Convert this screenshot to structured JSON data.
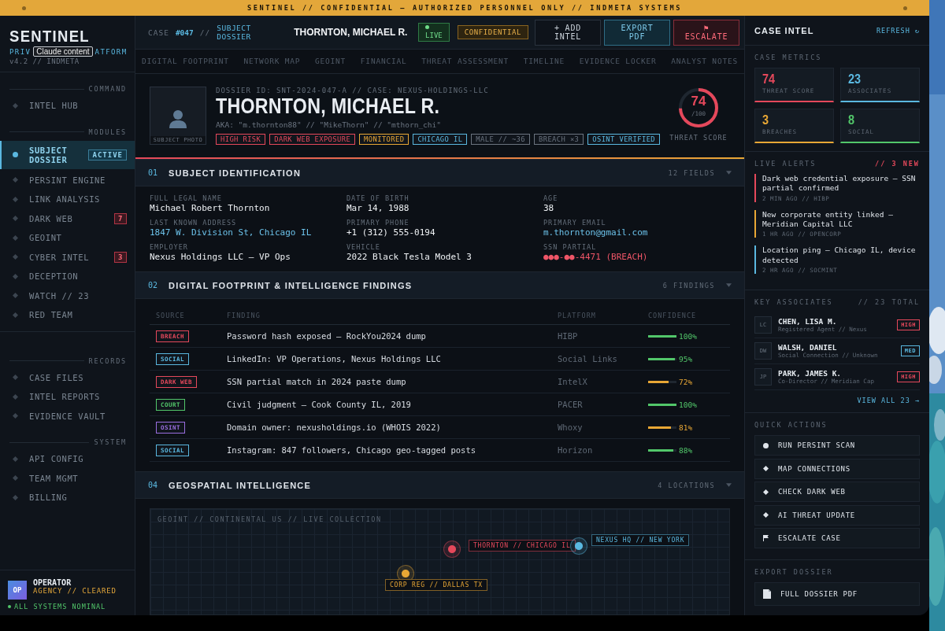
{
  "banner": {
    "text": "SENTINEL // CONFIDENTIAL — AUTHORIZED PERSONNEL ONLY // INDMETA SYSTEMS"
  },
  "sidebar": {
    "logo": "SENTINEL",
    "subtitle_left": "PRIV",
    "subtitle_right": "ATFORM",
    "tooltip": "Claude content",
    "version": "v4.2 // INDMETA",
    "sections": [
      {
        "title": "COMMAND",
        "items": [
          {
            "label": "INTEL HUB",
            "selected": false
          }
        ]
      },
      {
        "title": "MODULES",
        "items": [
          {
            "label": "SUBJECT DOSSIER",
            "selected": true,
            "badge": "ACTIVE"
          },
          {
            "label": "PERSINT ENGINE",
            "selected": false
          },
          {
            "label": "LINK ANALYSIS",
            "selected": false
          },
          {
            "label": "DARK WEB",
            "selected": false,
            "badge": "7"
          },
          {
            "label": "GEOINT",
            "selected": false
          },
          {
            "label": "CYBER INTEL",
            "selected": false,
            "badge": "3"
          },
          {
            "label": "DECEPTION",
            "selected": false
          },
          {
            "label": "WATCH // 23",
            "selected": false
          },
          {
            "label": "RED TEAM",
            "selected": false
          }
        ]
      },
      {
        "title": "RECORDS",
        "items": [
          {
            "label": "CASE FILES",
            "selected": false
          },
          {
            "label": "INTEL REPORTS",
            "selected": false
          },
          {
            "label": "EVIDENCE VAULT",
            "selected": false
          }
        ]
      },
      {
        "title": "SYSTEM",
        "items": [
          {
            "label": "API CONFIG",
            "selected": false
          },
          {
            "label": "TEAM MGMT",
            "selected": false
          },
          {
            "label": "BILLING",
            "selected": false
          }
        ]
      }
    ],
    "operator": {
      "initials": "OP",
      "name": "OPERATOR",
      "role": "AGENCY // CLEARED",
      "status": "ALL SYSTEMS NOMINAL"
    }
  },
  "header": {
    "case_label": "CASE",
    "case_number": "#047",
    "separator": "//",
    "section": "SUBJECT DOSSIER",
    "subject": "THORNTON, MICHAEL R.",
    "status": "LIVE",
    "classification": "CONFIDENTIAL",
    "buttons": [
      {
        "label": "+ ADD INTEL",
        "kind": "default"
      },
      {
        "label": "EXPORT PDF",
        "kind": "export"
      },
      {
        "label": "⚑ ESCALATE",
        "kind": "danger"
      }
    ]
  },
  "tabs": [
    {
      "label": "DIGITAL FOOTPRINT",
      "selected": false
    },
    {
      "label": "NETWORK MAP",
      "selected": false
    },
    {
      "label": "GEOINT",
      "selected": false
    },
    {
      "label": "FINANCIAL",
      "selected": false
    },
    {
      "label": "THREAT ASSESSMENT",
      "selected": false
    },
    {
      "label": "TIMELINE",
      "selected": false
    },
    {
      "label": "EVIDENCE LOCKER",
      "selected": false
    },
    {
      "label": "ANALYST NOTES",
      "selected": false
    }
  ],
  "dossier": {
    "photo_label": "SUBJECT PHOTO",
    "id_line": "DOSSIER ID: SNT-2024-047-A // CASE: NEXUS-HOLDINGS-LLC",
    "name": "THORNTON, MICHAEL R.",
    "aka": "AKA: \"m.thornton88\" // \"MikeThorn\" // \"mthorn_chi\"",
    "tags": [
      {
        "label": "HIGH RISK",
        "color": "#e5485b"
      },
      {
        "label": "DARK WEB EXPOSURE",
        "color": "#e5485b"
      },
      {
        "label": "MONITORED",
        "color": "#e8a735"
      },
      {
        "label": "CHICAGO IL",
        "color": "#5ab8e0"
      },
      {
        "label": "MALE // ~36",
        "color": "#6b7480"
      },
      {
        "label": "BREACH ×3",
        "color": "#6b7480"
      },
      {
        "label": "OSINT VERIFIED",
        "color": "#5ab8e0"
      }
    ],
    "threat": {
      "score": "74",
      "max": "/100",
      "label": "THREAT SCORE"
    }
  },
  "identification": {
    "number": "01",
    "title": "SUBJECT IDENTIFICATION",
    "count": "12 FIELDS",
    "fields": [
      {
        "label": "FULL LEGAL NAME",
        "value": "Michael Robert Thornton",
        "kind": "text"
      },
      {
        "label": "DATE OF BIRTH",
        "value": "Mar 14, 1988",
        "kind": "text"
      },
      {
        "label": "AGE",
        "value": "38",
        "kind": "text"
      },
      {
        "label": "LAST KNOWN ADDRESS",
        "value": "1847 W. Division St, Chicago IL",
        "kind": "link"
      },
      {
        "label": "PRIMARY PHONE",
        "value": "+1 (312) 555-0194",
        "kind": "text"
      },
      {
        "label": "PRIMARY EMAIL",
        "value": "m.thornton@gmail.com",
        "kind": "link"
      },
      {
        "label": "EMPLOYER",
        "value": "Nexus Holdings LLC — VP Ops",
        "kind": "text"
      },
      {
        "label": "VEHICLE",
        "value": "2022 Black Tesla Model 3",
        "kind": "text"
      },
      {
        "label": "SSN PARTIAL",
        "value": "●●●-●●-4471 (BREACH)",
        "kind": "alert"
      }
    ]
  },
  "findings": {
    "number": "02",
    "title": "DIGITAL FOOTPRINT & INTELLIGENCE FINDINGS",
    "count": "6 FINDINGS",
    "columns": [
      "SOURCE",
      "FINDING",
      "PLATFORM",
      "CONFIDENCE"
    ],
    "rows": [
      {
        "source": "BREACH",
        "color": "#e5485b",
        "finding": "Password hash exposed — RockYou2024 dump",
        "platform": "HIBP",
        "level": 1.0,
        "confidence": "100%"
      },
      {
        "source": "SOCIAL",
        "color": "#5ab8e0",
        "finding": "LinkedIn: VP Operations, Nexus Holdings LLC",
        "platform": "Social Links",
        "level": 0.95,
        "confidence": "95%"
      },
      {
        "source": "DARK WEB",
        "color": "#e5485b",
        "finding": "SSN partial match in 2024 paste dump",
        "platform": "IntelX",
        "level": 0.72,
        "confidence": "72%"
      },
      {
        "source": "COURT",
        "color": "#52c76a",
        "finding": "Civil judgment — Cook County IL, 2019",
        "platform": "PACER",
        "level": 1.0,
        "confidence": "100%"
      },
      {
        "source": "OSINT",
        "color": "#9a6ee0",
        "finding": "Domain owner: nexusholdings.io (WHOIS 2022)",
        "platform": "Whoxy",
        "level": 0.81,
        "confidence": "81%"
      },
      {
        "source": "SOCIAL",
        "color": "#5ab8e0",
        "finding": "Instagram: 847 followers, Chicago geo-tagged posts",
        "platform": "Horizon",
        "level": 0.88,
        "confidence": "88%"
      }
    ]
  },
  "geospatial": {
    "number": "04",
    "title": "GEOSPATIAL INTELLIGENCE",
    "count": "4 LOCATIONS",
    "map_caption": "GEOINT // CONTINENTAL US // LIVE COLLECTION",
    "pins": [
      {
        "label": "THORNTON // CHICAGO IL",
        "color": "#e5485b"
      },
      {
        "label": "NEXUS HQ // NEW YORK",
        "color": "#5ab8e0"
      },
      {
        "label": "CORP REG // DALLAS TX",
        "color": "#e8a735"
      }
    ]
  },
  "intel": {
    "title": "CASE INTEL",
    "refresh": "REFRESH ↻",
    "metrics_title": "CASE METRICS",
    "metrics": [
      {
        "value": "74",
        "label": "THREAT SCORE",
        "color": "#e5485b"
      },
      {
        "value": "23",
        "label": "ASSOCIATES",
        "color": "#5ab8e0"
      },
      {
        "value": "3",
        "label": "BREACHES",
        "color": "#e8a735"
      },
      {
        "value": "8",
        "label": "SOCIAL",
        "color": "#52c76a"
      }
    ],
    "alerts_title": "LIVE ALERTS",
    "alerts_count": "// 3 NEW",
    "alerts": [
      {
        "text": "Dark web credential exposure — SSN partial confirmed",
        "meta": "2 MIN AGO // HIBP",
        "color": "#e5485b"
      },
      {
        "text": "New corporate entity linked — Meridian Capital LLC",
        "meta": "1 HR AGO // OPENCORP",
        "color": "#e8a735"
      },
      {
        "text": "Location ping — Chicago IL, device detected",
        "meta": "2 HR AGO // SOCMINT",
        "color": "#5ab8e0"
      }
    ],
    "associates_title": "KEY ASSOCIATES",
    "associates_count": "// 23 TOTAL",
    "associates": [
      {
        "initials": "LC",
        "name": "CHEN, LISA M.",
        "role": "Registered Agent // Nexus",
        "risk": "HIGH",
        "color": "#e5485b"
      },
      {
        "initials": "DW",
        "name": "WALSH, DANIEL",
        "role": "Social Connection // Unknown",
        "risk": "MED",
        "color": "#5ab8e0"
      },
      {
        "initials": "JP",
        "name": "PARK, JAMES K.",
        "role": "Co-Director // Meridian Cap",
        "risk": "HIGH",
        "color": "#e5485b"
      }
    ],
    "view_all": "VIEW ALL 23 →",
    "actions_title": "QUICK ACTIONS",
    "actions": [
      {
        "label": "RUN PERSINT SCAN",
        "kind": "dot"
      },
      {
        "label": "MAP CONNECTIONS",
        "kind": "diamond"
      },
      {
        "label": "CHECK DARK WEB",
        "kind": "diamond"
      },
      {
        "label": "AI THREAT UPDATE",
        "kind": "diamond"
      },
      {
        "label": "ESCALATE CASE",
        "kind": "flag"
      }
    ],
    "export_title": "EXPORT DOSSIER",
    "exports": [
      {
        "label": "FULL DOSSIER PDF",
        "kind": "document"
      }
    ]
  }
}
